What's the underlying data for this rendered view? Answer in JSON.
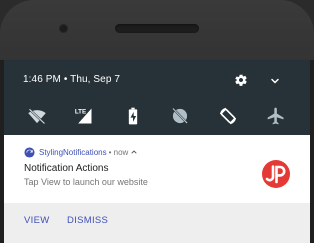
{
  "status": {
    "datetime": "1:46 PM • Thu, Sep 7"
  },
  "quick_settings": {
    "tiles": [
      "wifi-off-icon",
      "lte-signal-icon",
      "battery-charging-icon",
      "do-not-disturb-icon",
      "auto-rotate-icon",
      "airplane-mode-icon"
    ]
  },
  "notification": {
    "app_name": "StylingNotifications",
    "meta": "• now",
    "title": "Notification Actions",
    "text": "Tap View to launch our website",
    "actions": {
      "view": "VIEW",
      "dismiss": "DISMISS"
    }
  },
  "colors": {
    "shade_bg": "#263238",
    "accent": "#3f51b5",
    "logo_red": "#e53935",
    "action_bar_bg": "#eeeeee"
  }
}
